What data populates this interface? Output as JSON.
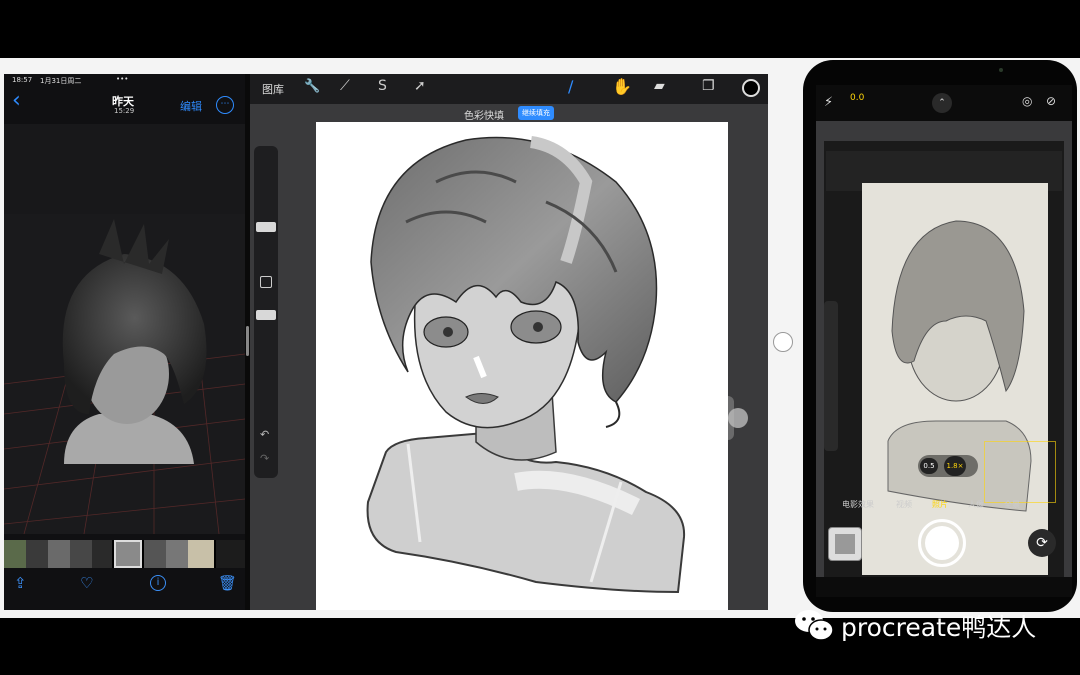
{
  "photos": {
    "status_time": "18:57",
    "status_date": "1月31日周二",
    "status_dots": "•••",
    "title": "昨天",
    "subtitle": "15:29",
    "edit_label": "编辑",
    "back_glyph": "‹",
    "more_glyph": "⋯"
  },
  "procreate": {
    "gallery_label": "图库",
    "banner_text": "色彩快填",
    "banner_button": "继续填充"
  },
  "camera": {
    "exposure": "0.0",
    "zoom_options": [
      "0.5",
      "1.8×"
    ],
    "modes": [
      "电影效果",
      "视频",
      "照片",
      "人像",
      "全景"
    ],
    "selected_mode": "照片"
  },
  "watermark": {
    "text": "procreate鸭达人"
  },
  "colors": {
    "accent": "#2f8cff",
    "camera_yellow": "#ffd60a",
    "frame": "#f4f4f4"
  }
}
